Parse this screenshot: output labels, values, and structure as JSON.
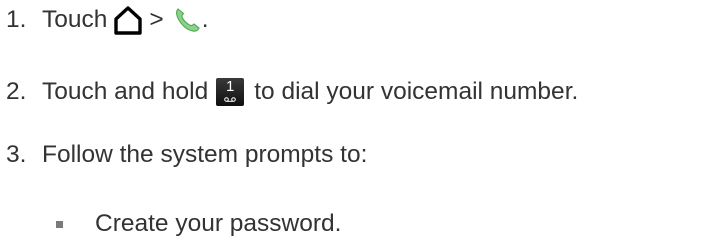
{
  "steps": [
    {
      "num": "1.",
      "text_a": "Touch",
      "text_b": ">",
      "text_c": "."
    },
    {
      "num": "2.",
      "text_a": "Touch and hold",
      "key_digit": "1",
      "text_b": "to dial your voicemail number."
    },
    {
      "num": "3.",
      "text_a": "Follow the system prompts to:"
    }
  ],
  "bullets": [
    {
      "text": "Create your password."
    }
  ],
  "icons": {
    "home": "home-icon",
    "phone": "phone-icon",
    "voicemail_key": "voicemail-key-icon"
  },
  "colors": {
    "text": "#333333",
    "phone_green": "#4caf50",
    "key_bg": "#1a1a1a"
  }
}
